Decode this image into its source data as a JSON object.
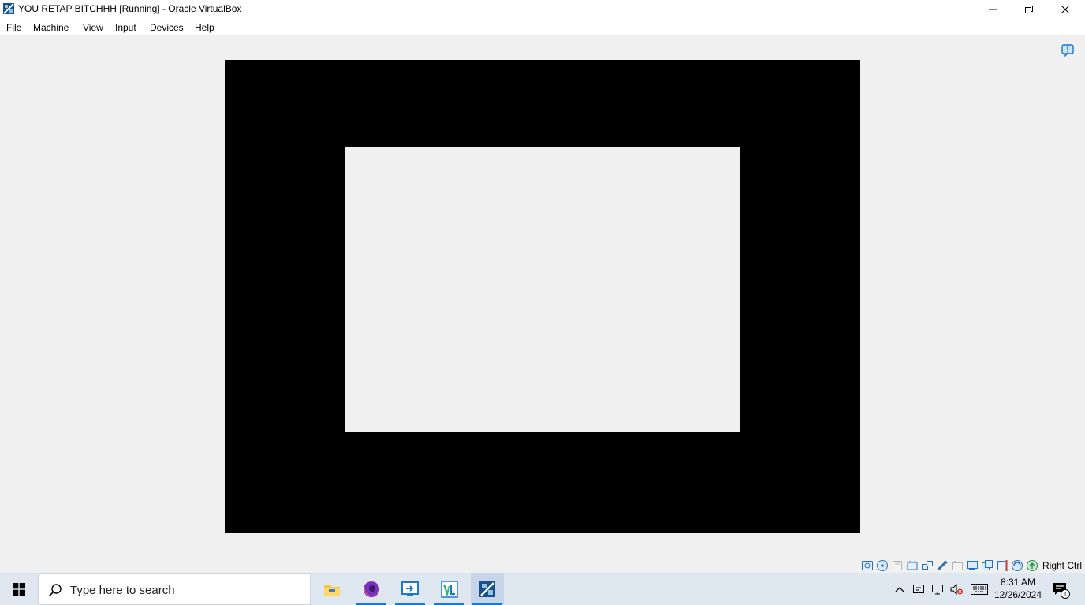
{
  "window": {
    "title": "YOU RETAP BITCHHH [Running] - Oracle VirtualBox",
    "icon": "virtualbox-icon"
  },
  "menu": {
    "items": [
      "File",
      "Machine",
      "View",
      "Input",
      "Devices",
      "Help"
    ]
  },
  "status_bar": {
    "icons": [
      "hard-disk-icon",
      "optical-drive-icon",
      "floppy-icon",
      "audio-icon",
      "network-icon",
      "usb-icon",
      "shared-folders-icon",
      "display-icon",
      "recording-icon",
      "cpu-icon",
      "mouse-integration-icon",
      "keyboard-capture-icon"
    ],
    "host_key": "Right Ctrl"
  },
  "taskbar": {
    "search_placeholder": "Type here to search",
    "apps": [
      "file-explorer-icon",
      "firefox-icon",
      "remote-desktop-icon",
      "visual-studio-icon",
      "virtualbox-icon"
    ],
    "time": "8:31 AM",
    "date": "12/26/2024",
    "notification_count": "1"
  },
  "colors": {
    "accent": "#1e78d2",
    "vm_background": "#000000",
    "taskbar": "#dfe8f1"
  }
}
